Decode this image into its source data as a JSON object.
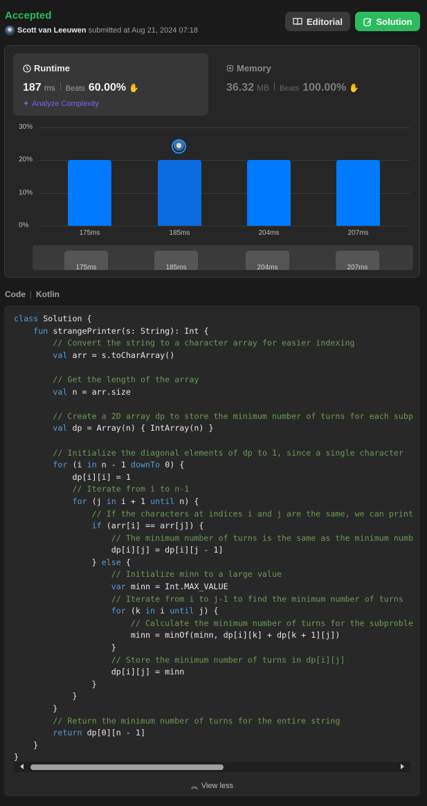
{
  "header": {
    "status": "Accepted",
    "user": "Scott van Leeuwen",
    "submitted_text": "submitted at Aug 21, 2024 07:18",
    "editorial_label": "Editorial",
    "solution_label": "Solution"
  },
  "runtime": {
    "title": "Runtime",
    "value": "187",
    "unit": "ms",
    "beats_label": "Beats",
    "beats": "60.00%",
    "analyze_label": "Analyze Complexity"
  },
  "memory": {
    "title": "Memory",
    "value": "36.32",
    "unit": "MB",
    "beats_label": "Beats",
    "beats": "100.00%"
  },
  "chart_data": {
    "type": "bar",
    "categories": [
      "175ms",
      "185ms",
      "204ms",
      "207ms"
    ],
    "values": [
      20,
      20,
      20,
      20
    ],
    "y_ticks": [
      "30%",
      "20%",
      "10%",
      "0%"
    ],
    "ylim": [
      0,
      30
    ],
    "selected_category": "185ms",
    "bar_color": "#007aff",
    "grid": true
  },
  "code": {
    "label": "Code",
    "language": "Kotlin",
    "view_less_label": "View less",
    "lines": [
      "class Solution {",
      "    fun strangePrinter(s: String): Int {",
      "        // Convert the string to a character array for easier indexing",
      "        val arr = s.toCharArray()",
      "",
      "        // Get the length of the array",
      "        val n = arr.size",
      "",
      "        // Create a 2D array dp to store the minimum number of turns for each subp",
      "        val dp = Array(n) { IntArray(n) }",
      "",
      "        // Initialize the diagonal elements of dp to 1, since a single character",
      "        for (i in n - 1 downTo 0) {",
      "            dp[i][i] = 1",
      "            // Iterate from i to n-1",
      "            for (j in i + 1 until n) {",
      "                // If the characters at indices i and j are the same, we can print",
      "                if (arr[i] == arr[j]) {",
      "                    // The minimum number of turns is the same as the minimum numb",
      "                    dp[i][j] = dp[i][j - 1]",
      "                } else {",
      "                    // Initialize minn to a large value",
      "                    var minn = Int.MAX_VALUE",
      "                    // Iterate from i to j-1 to find the minimum number of turns",
      "                    for (k in i until j) {",
      "                        // Calculate the minimum number of turns for the subproble",
      "                        minn = minOf(minn, dp[i][k] + dp[k + 1][j])",
      "                    }",
      "                    // Store the minimum number of turns in dp[i][j]",
      "                    dp[i][j] = minn",
      "                }",
      "            }",
      "        }",
      "        // Return the minimum number of turns for the entire string",
      "        return dp[0][n - 1]",
      "    }",
      "}"
    ]
  },
  "colors": {
    "accepted": "#2cbb5d",
    "keyword": "#569cd6",
    "comment": "#6a9955",
    "analyze": "#7a65f0"
  }
}
